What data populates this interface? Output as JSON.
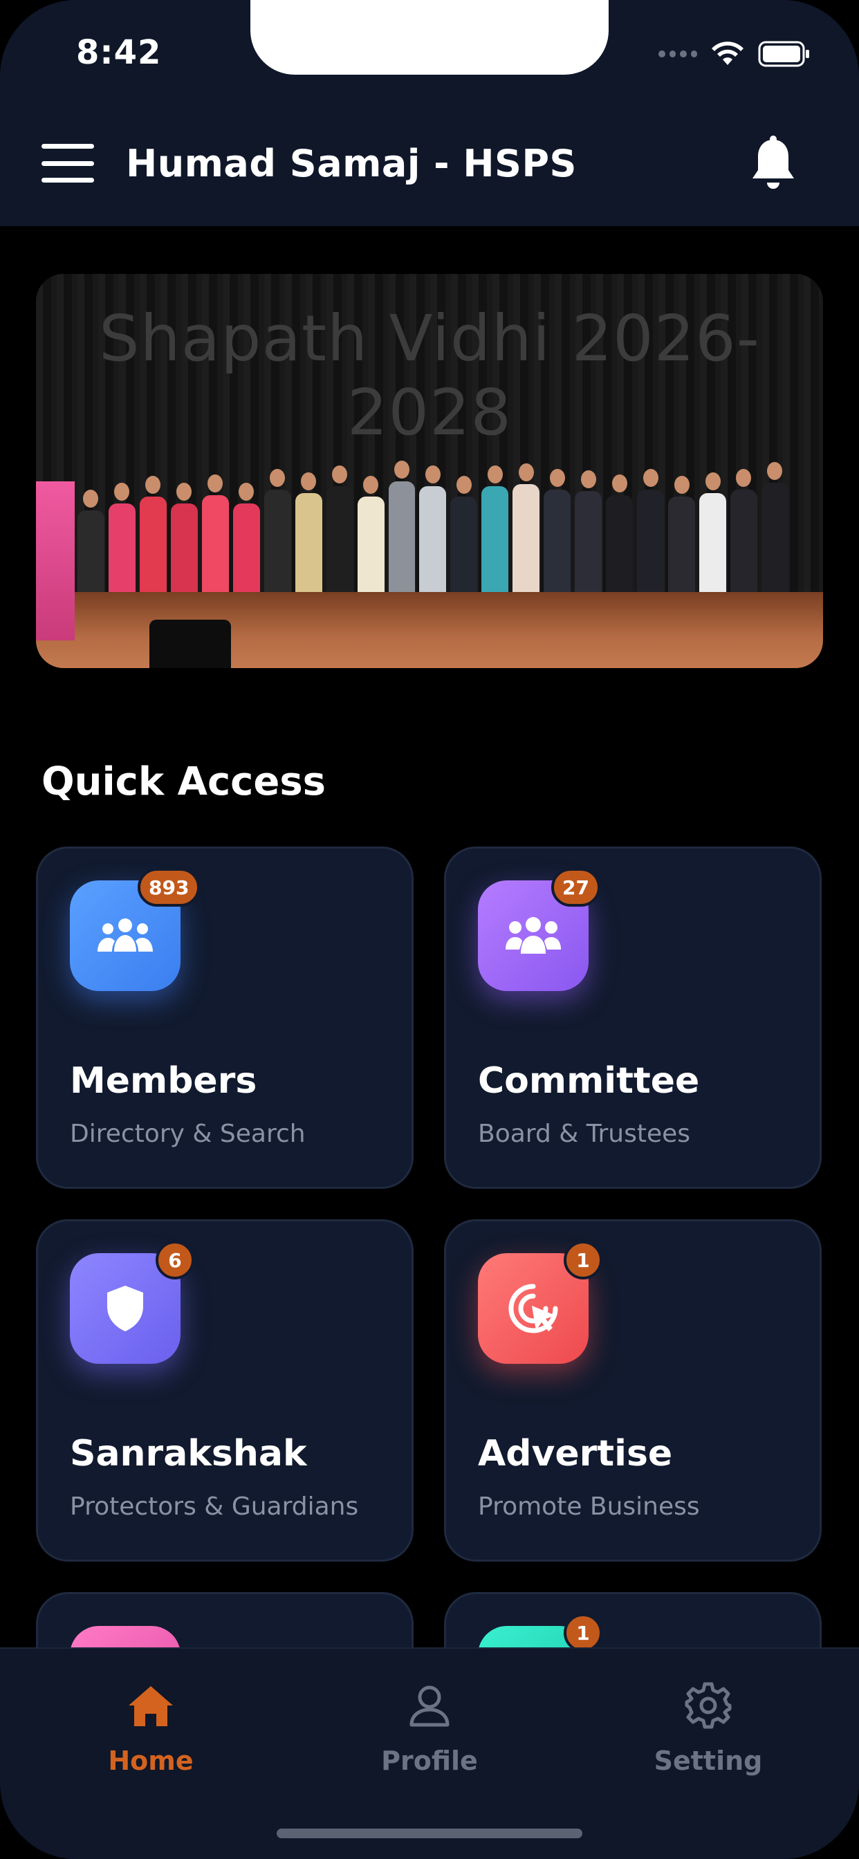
{
  "status_bar": {
    "time": "8:42"
  },
  "header": {
    "title": "Humad Samaj - HSPS",
    "menu_icon": "hamburger-icon",
    "notification_icon": "bell-icon"
  },
  "banner": {
    "caption": "Shapath Vidhi 2026-2028"
  },
  "quick_access": {
    "title": "Quick Access",
    "cards": [
      {
        "title": "Members",
        "subtitle": "Directory & Search",
        "badge": "893",
        "icon": "users-icon",
        "color": "#4a8cf7"
      },
      {
        "title": "Committee",
        "subtitle": "Board & Trustees",
        "badge": "27",
        "icon": "group-icon",
        "color": "#9b6bf7"
      },
      {
        "title": "Sanrakshak",
        "subtitle": "Protectors & Guardians",
        "badge": "6",
        "icon": "shield-icon",
        "color": "#7b72f5"
      },
      {
        "title": "Advertise",
        "subtitle": "Promote Business",
        "badge": "1",
        "icon": "target-cursor-icon",
        "color": "#f25f60"
      },
      {
        "title": "",
        "subtitle": "",
        "badge": "",
        "icon": "",
        "color": "#f05fb2"
      },
      {
        "title": "",
        "subtitle": "",
        "badge": "1",
        "icon": "",
        "color": "#22dcbb"
      }
    ]
  },
  "bottom_nav": {
    "items": [
      {
        "label": "Home",
        "icon": "home-icon",
        "active": true
      },
      {
        "label": "Profile",
        "icon": "user-icon",
        "active": false
      },
      {
        "label": "Setting",
        "icon": "gear-icon",
        "active": false
      }
    ],
    "active_color": "#d3631f"
  }
}
